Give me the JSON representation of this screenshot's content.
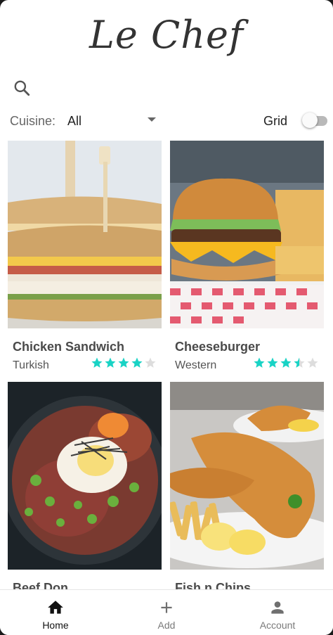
{
  "app": {
    "logo_text": "Le Chef"
  },
  "filter": {
    "cuisine_label": "Cuisine:",
    "cuisine_value": "All",
    "grid_label": "Grid",
    "grid_enabled": false
  },
  "colors": {
    "star_filled": "#19d3c5",
    "star_empty": "#dddddd",
    "nav_active": "#111111",
    "nav_inactive": "#7a7a7a"
  },
  "recipes": [
    {
      "name": "Chicken Sandwich",
      "cuisine": "Turkish",
      "rating": 4,
      "image": "chicken-sandwich-photo"
    },
    {
      "name": "Cheeseburger",
      "cuisine": "Western",
      "rating": 3.5,
      "image": "cheeseburger-photo"
    },
    {
      "name": "Beef Don",
      "cuisine": "",
      "rating": null,
      "image": "beef-don-photo"
    },
    {
      "name": "Fish n Chips",
      "cuisine": "",
      "rating": null,
      "image": "fish-n-chips-photo"
    }
  ],
  "bottom_nav": [
    {
      "label": "Home",
      "icon": "home-icon",
      "active": true
    },
    {
      "label": "Add",
      "icon": "add-icon",
      "active": false
    },
    {
      "label": "Account",
      "icon": "account-icon",
      "active": false
    }
  ]
}
